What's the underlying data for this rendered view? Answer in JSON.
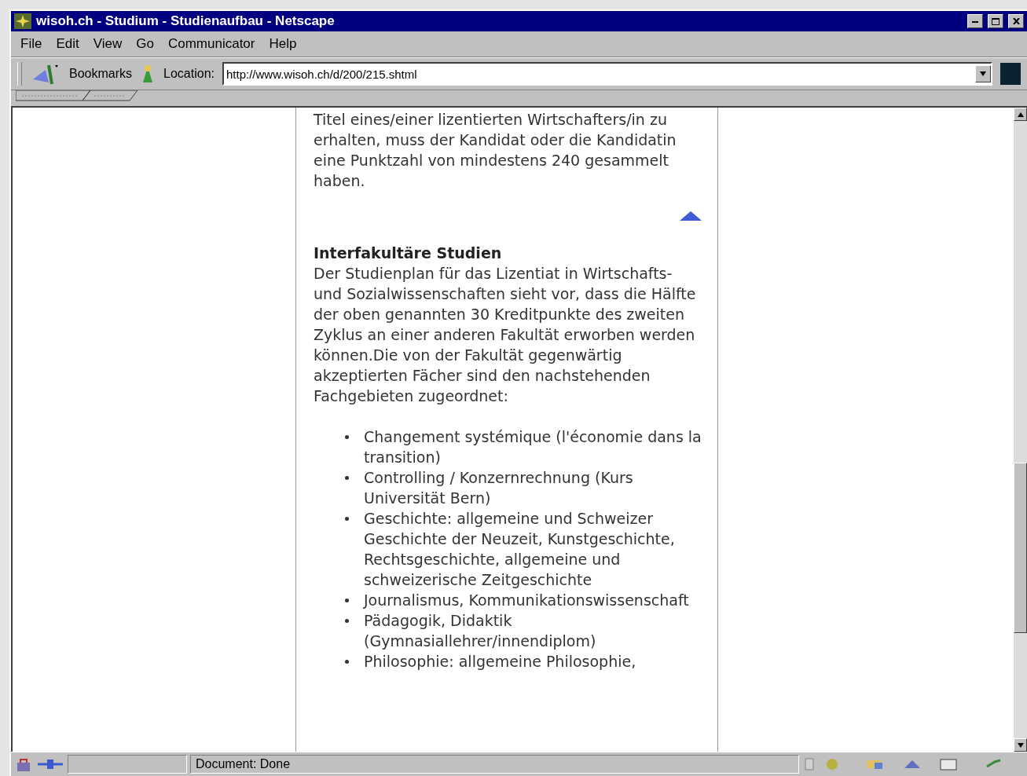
{
  "window": {
    "title": "wisoh.ch - Studium - Studienaufbau - Netscape"
  },
  "menu": [
    "File",
    "Edit",
    "View",
    "Go",
    "Communicator",
    "Help"
  ],
  "toolbar": {
    "bookmarks": "Bookmarks",
    "location_label": "Location:",
    "url": "http://www.wisoh.ch/d/200/215.shtml"
  },
  "content": {
    "intro": "Titel eines/einer lizentierten Wirtschafters/in zu erhalten, muss der Kandidat oder die Kandidatin eine Punktzahl von mindestens 240 gesammelt haben.",
    "heading": "Interfakultäre Studien",
    "paragraph": "Der Studienplan für das Lizentiat in Wirtschafts- und Sozialwissenschaften sieht vor, dass die Hälfte der oben genannten 30 Kreditpunkte des zweiten Zyklus an einer anderen Fakultät erworben werden können.Die von der Fakultät gegenwärtig akzeptierten Fächer sind den nachstehenden Fachgebieten zugeordnet:",
    "list": [
      "Changement systémique (l'économie dans la transition)",
      "Controlling / Konzernrechnung (Kurs Universität Bern)",
      "Geschichte: allgemeine und Schweizer Geschichte der Neuzeit, Kunstgeschichte, Rechtsgeschichte, allgemeine und schweizerische Zeitgeschichte",
      "Journalismus, Kommunikationswissenschaft",
      "Pädagogik, Didaktik (Gymnasiallehrer/innendiplom)",
      "Philosophie: allgemeine Philosophie,"
    ]
  },
  "status_bar": {
    "text": "Document: Done"
  }
}
